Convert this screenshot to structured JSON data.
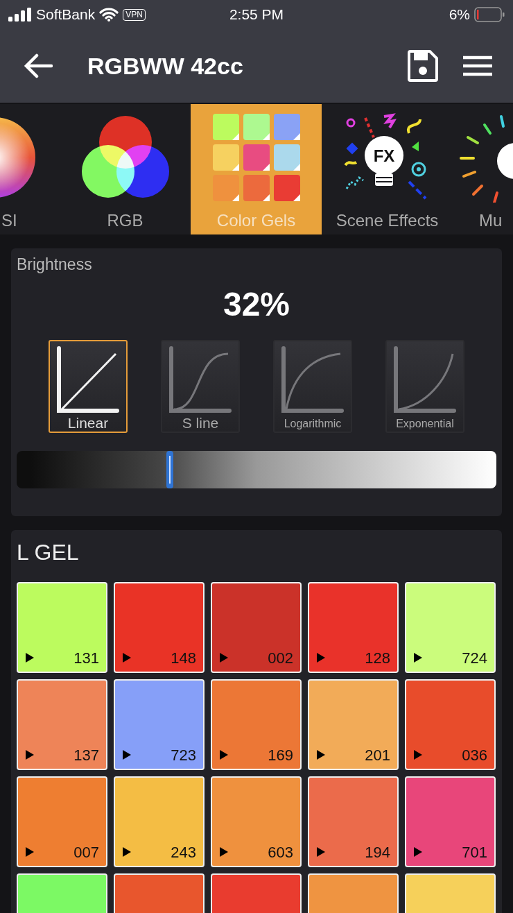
{
  "status_bar": {
    "carrier": "SoftBank",
    "vpn": "VPN",
    "time": "2:55 PM",
    "battery": "6%"
  },
  "header": {
    "title": "RGBWW 42cc"
  },
  "modes": [
    {
      "kind": "wheel",
      "label": "SI",
      "selected": false
    },
    {
      "kind": "rgb",
      "label": "RGB",
      "selected": false
    },
    {
      "kind": "gels",
      "label": "Color Gels",
      "selected": true
    },
    {
      "kind": "fx",
      "label": "Scene Effects",
      "badge": "FX",
      "selected": false
    },
    {
      "kind": "music",
      "label": "Mu",
      "selected": false
    }
  ],
  "brightness": {
    "title": "Brightness",
    "value": "32%",
    "level": 0.32,
    "curves": [
      {
        "kind": "linear",
        "label": "Linear",
        "selected": true
      },
      {
        "kind": "s",
        "label": "S line",
        "selected": false
      },
      {
        "kind": "log",
        "label": "Logarithmic",
        "selected": false
      },
      {
        "kind": "exp",
        "label": "Exponential",
        "selected": false
      }
    ]
  },
  "gel_panel": {
    "title": "L GEL",
    "gels": [
      {
        "number": "131",
        "color": "#bcfb5e"
      },
      {
        "number": "148",
        "color": "#e93326"
      },
      {
        "number": "002",
        "color": "#cb3229"
      },
      {
        "number": "128",
        "color": "#e9322a"
      },
      {
        "number": "724",
        "color": "#cbfc7c"
      },
      {
        "number": "137",
        "color": "#ee8458"
      },
      {
        "number": "723",
        "color": "#869ff8"
      },
      {
        "number": "169",
        "color": "#ec7736"
      },
      {
        "number": "201",
        "color": "#f2ab58"
      },
      {
        "number": "036",
        "color": "#e84c2b"
      },
      {
        "number": "007",
        "color": "#ee7e31"
      },
      {
        "number": "243",
        "color": "#f4bd44"
      },
      {
        "number": "603",
        "color": "#ef913e"
      },
      {
        "number": "194",
        "color": "#eb6b4b"
      },
      {
        "number": "701",
        "color": "#e8467a"
      },
      {
        "color": "#7cf964"
      },
      {
        "color": "#e8562d"
      },
      {
        "color": "#e93c2f"
      },
      {
        "color": "#ef9441"
      },
      {
        "color": "#f6d05a"
      }
    ]
  }
}
